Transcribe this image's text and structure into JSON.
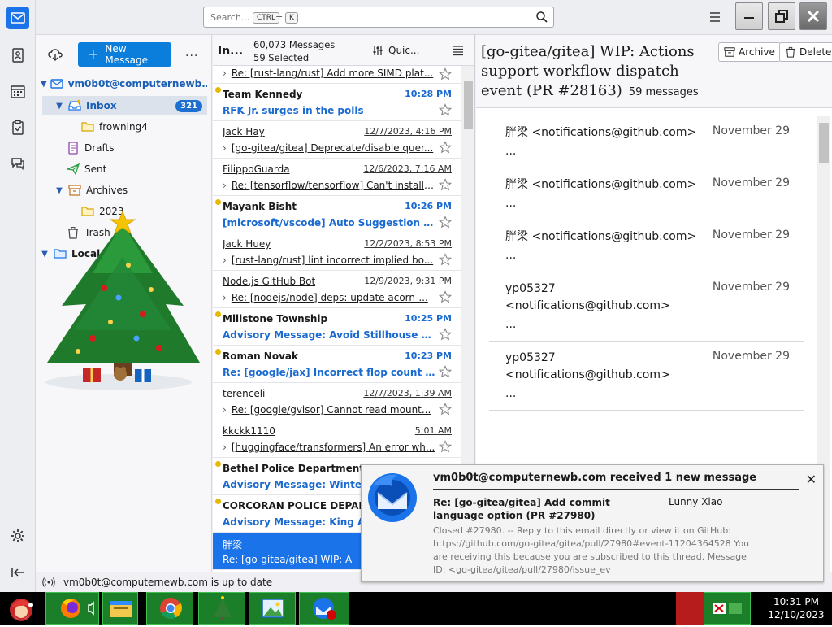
{
  "search": {
    "placeholder": "Search...",
    "key1": "CTRL",
    "key2": "K",
    "plus": "+"
  },
  "folderpane": {
    "new_message": "New Message",
    "more": "...",
    "account": "vm0b0t@computernewb...",
    "folders": [
      {
        "label": "Inbox",
        "badge": "321"
      },
      {
        "label": "frowning4"
      },
      {
        "label": "Drafts"
      },
      {
        "label": "Sent"
      },
      {
        "label": "Archives"
      },
      {
        "label": "2023"
      },
      {
        "label": "Trash"
      },
      {
        "label": "Local"
      }
    ]
  },
  "status": {
    "text": "vm0b0t@computernewb.com is up to date"
  },
  "msglist": {
    "folder": "In...",
    "total": "60,073 Messages",
    "selected": "59 Selected",
    "quick": "Quic...",
    "rows": [
      {
        "sender": "",
        "date": "",
        "subject": "Re: [rust-lang/rust] Add more SIMD plat...",
        "state": "read",
        "partial": true
      },
      {
        "sender": "Team Kennedy",
        "date": "10:28 PM",
        "subject": "RFK Jr. surges in the polls",
        "state": "unread"
      },
      {
        "sender": "Jack Hay",
        "date": "12/7/2023, 4:16 PM",
        "subject": "[go-gitea/gitea] Deprecate/disable quer...",
        "state": "read"
      },
      {
        "sender": "FilippoGuarda",
        "date": "12/6/2023, 7:16 AM",
        "subject": "Re: [tensorflow/tensorflow] Can't install t...",
        "state": "read"
      },
      {
        "sender": "Mayank Bisht",
        "date": "10:26 PM",
        "subject": "[microsoft/vscode] Auto Suggestion Fre...",
        "state": "unread"
      },
      {
        "sender": "Jack Huey",
        "date": "12/2/2023, 8:53 PM",
        "subject": "[rust-lang/rust] lint incorrect implied bo...",
        "state": "read"
      },
      {
        "sender": "Node.js GitHub Bot",
        "date": "12/9/2023, 9:31 PM",
        "subject": "Re: [nodejs/node] deps: update acorn-...",
        "state": "read"
      },
      {
        "sender": "Millstone Township",
        "date": "10:25 PM",
        "subject": "Advisory Message: Avoid Stillhouse goi...",
        "state": "unread"
      },
      {
        "sender": "Roman Novak",
        "date": "10:23 PM",
        "subject": "Re: [google/jax] Incorrect flop count es...",
        "state": "unread"
      },
      {
        "sender": "terenceli",
        "date": "12/7/2023, 1:39 AM",
        "subject": "Re: [google/gvisor] Cannot read mount...",
        "state": "read"
      },
      {
        "sender": "kkckk1110",
        "date": "5:01 AM",
        "subject": "[huggingface/transformers] An error wh...",
        "state": "read"
      },
      {
        "sender": "Bethel Police Department AK",
        "date": "",
        "subject": "Advisory Message: Winter W",
        "state": "unread"
      },
      {
        "sender": "CORCORAN POLICE DEPARTME",
        "date": "",
        "subject": "Advisory Message: King Ave",
        "state": "unread"
      },
      {
        "sender": "胖梁",
        "date": "",
        "subject": "Re: [go-gitea/gitea] WIP: A",
        "state": "selected"
      }
    ]
  },
  "reading": {
    "title": "[go-gitea/gitea] WIP: Actions support workflow dispatch event (PR #28163)",
    "count": "59 messages",
    "archive": "Archive",
    "delete": "Delete",
    "cards": [
      {
        "from": "胖梁 <notifications@github.com>",
        "date": "November 29",
        "ellipsis": "..."
      },
      {
        "from": "胖梁 <notifications@github.com>",
        "date": "November 29",
        "ellipsis": "..."
      },
      {
        "from": "胖梁 <notifications@github.com>",
        "date": "November 29",
        "ellipsis": "..."
      },
      {
        "from": "yp05327 <notifications@github.com>",
        "date": "November 29",
        "ellipsis": "..."
      },
      {
        "from": "yp05327 <notifications@github.com>",
        "date": "November 29",
        "ellipsis": "..."
      }
    ]
  },
  "notification": {
    "title": "vm0b0t@computernewb.com received 1 new message",
    "subject": "Re: [go-gitea/gitea] Add commit language option (PR #27980)",
    "from": "Lunny Xiao",
    "body": "Closed #27980. -- Reply to this email directly or view it on GitHub: https://github.com/go-gitea/gitea/pull/27980#event-11204364528 You are receiving this because you are subscribed to this thread. Message ID: <go-gitea/gitea/pull/27980/issue_ev"
  },
  "taskbar": {
    "time": "10:31 PM",
    "date": "12/10/2023"
  },
  "colors": {
    "accent": "#1a73e8",
    "unread": "#1a6ad0",
    "badge": "#1d6fd0",
    "taskbar": "#000000"
  }
}
